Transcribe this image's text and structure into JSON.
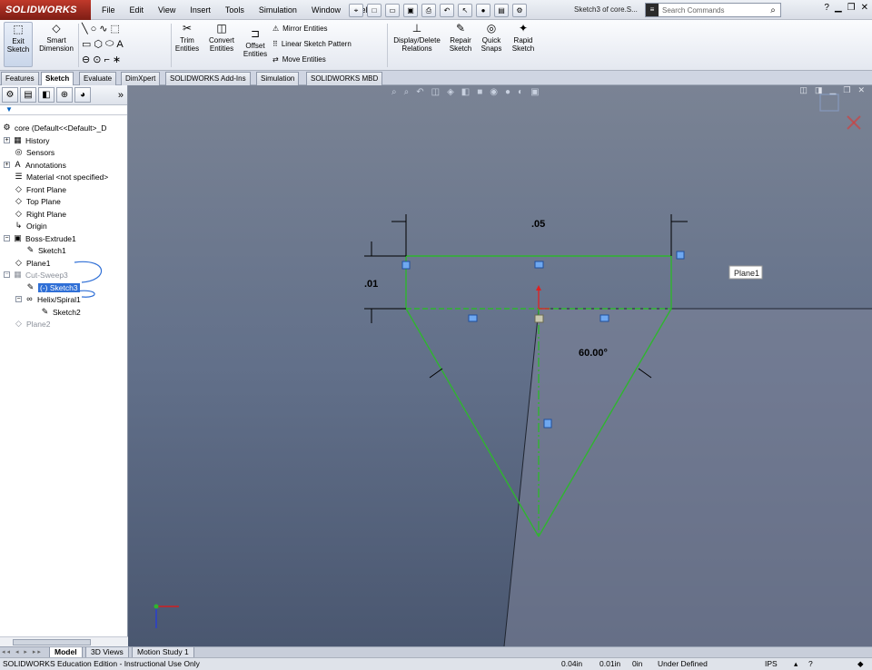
{
  "app": {
    "logo": "SOLIDWORKS"
  },
  "menu": [
    "File",
    "Edit",
    "View",
    "Insert",
    "Tools",
    "Simulation",
    "Window",
    "Help"
  ],
  "title": {
    "doc": "Sketch3 of core.S..."
  },
  "search": {
    "placeholder": "Search Commands"
  },
  "ribbon": {
    "exit_sketch": "Exit Sketch",
    "smart_dimension": "Smart Dimension",
    "trim": "Trim Entities",
    "convert": "Convert Entities",
    "offset": "Offset Entities",
    "mirror": "Mirror Entities",
    "linear_pattern": "Linear Sketch Pattern",
    "move": "Move Entities",
    "display_relations": "Display/Delete Relations",
    "repair": "Repair Sketch",
    "quick_snaps": "Quick Snaps",
    "rapid_sketch": "Rapid Sketch"
  },
  "tabs": [
    "Features",
    "Sketch",
    "Evaluate",
    "DimXpert",
    "SOLIDWORKS Add-Ins",
    "Simulation",
    "SOLIDWORKS MBD"
  ],
  "active_tab": "Sketch",
  "tree": {
    "root": "core  (Default<<Default>_D",
    "items": [
      "History",
      "Sensors",
      "Annotations",
      "Material <not specified>",
      "Front Plane",
      "Top Plane",
      "Right Plane",
      "Origin",
      "Boss-Extrude1",
      "Sketch1",
      "Plane1",
      "Cut-Sweep3",
      "(-) Sketch3",
      "Helix/Spiral1",
      "Sketch2",
      "Plane2"
    ]
  },
  "sketch": {
    "dim_width": ".05",
    "dim_height": ".01",
    "dim_angle": "60.00°",
    "plane_label": "Plane1",
    "colors": {
      "sketch_line": "#2fb52f",
      "dimension": "#000000",
      "relation": "#3a8ee6"
    }
  },
  "bottom_tabs": [
    "Model",
    "3D Views",
    "Motion Study 1"
  ],
  "active_bottom_tab": "Model",
  "status": {
    "edition": "SOLIDWORKS Education Edition - Instructional Use Only",
    "x": "0.04in",
    "y": "0.01in",
    "z": "0in",
    "state": "Under Defined",
    "units": "IPS"
  }
}
